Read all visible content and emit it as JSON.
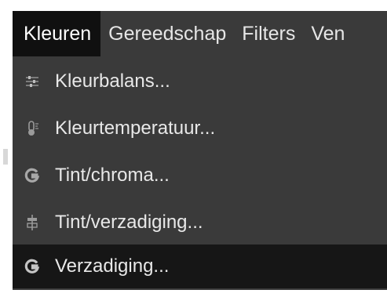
{
  "menubar": {
    "items": [
      {
        "label": "Kleuren"
      },
      {
        "label": "Gereedschap"
      },
      {
        "label": "Filters"
      },
      {
        "label": "Ven"
      }
    ]
  },
  "menu": {
    "items": [
      {
        "label": "Kleurbalans...",
        "icon": "sliders-icon"
      },
      {
        "label": "Kleurtemperatuur...",
        "icon": "thermometer-icon"
      },
      {
        "label": "Tint/chroma...",
        "icon": "gegl-icon"
      },
      {
        "label": "Tint/verzadiging...",
        "icon": "hue-saturation-icon"
      },
      {
        "label": "Verzadiging...",
        "icon": "gegl-icon"
      }
    ],
    "selected_index": 4
  },
  "colors": {
    "menu_background": "#3a3a3a",
    "active_background": "#101010",
    "text": "#e8e8e8",
    "icon": "#9a9a9a"
  }
}
